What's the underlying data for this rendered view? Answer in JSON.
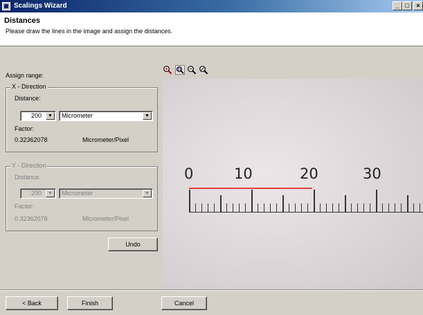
{
  "window": {
    "title": "Scalings Wizard",
    "min": "_",
    "max": "□",
    "close": "×"
  },
  "header": {
    "title": "Distances",
    "description": "Please draw the lines in the image and assign the distances."
  },
  "assign_range_label": "Assign range:",
  "x_direction": {
    "legend": "X - Direction",
    "distance_label": "Distance:",
    "distance_value": "200",
    "unit_value": "Micrometer",
    "factor_label": "Factor:",
    "factor_value": "0.32362078",
    "factor_unit": "Micrometer/Pixel"
  },
  "y_direction": {
    "legend": "Y - Direction",
    "distance_label": "Distance:",
    "distance_value": "200",
    "unit_value": "Micrometer",
    "factor_label": "Factor:",
    "factor_value": "0.32362078",
    "factor_unit": "Micrometer/Pixel"
  },
  "buttons": {
    "undo": "Undo",
    "back": "< Back",
    "finish": "Finish",
    "cancel": "Cancel"
  },
  "dropdown_arrow": "▼",
  "toolbar": {
    "icons": [
      "zoom-in-icon",
      "zoom-fit-icon",
      "zoom-out-icon",
      "zoom-reset-icon"
    ],
    "active_index": 1
  },
  "ruler": {
    "labels": [
      "0",
      "10",
      "20",
      "30"
    ]
  },
  "colors": {
    "measure_line": "#e04040",
    "title_bar": "#0a246a"
  }
}
